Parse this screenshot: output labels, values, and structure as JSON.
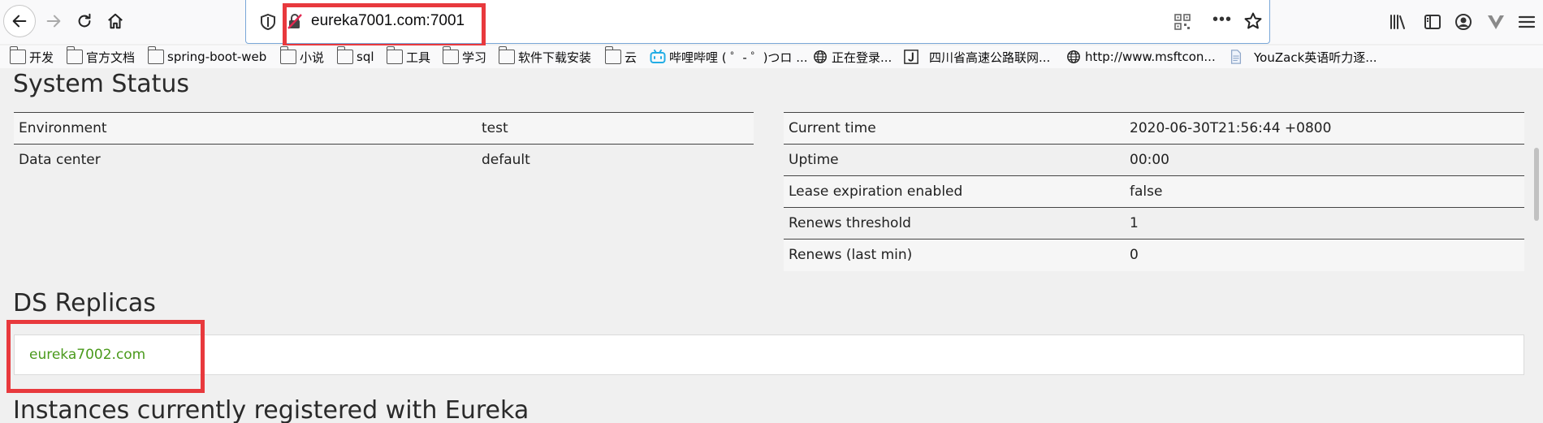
{
  "browser": {
    "url": "eureka7001.com:7001",
    "bookmarks": [
      {
        "label": "开发",
        "icon": "folder-icon"
      },
      {
        "label": "官方文档",
        "icon": "folder-icon"
      },
      {
        "label": "spring-boot-web",
        "icon": "folder-icon"
      },
      {
        "label": "小说",
        "icon": "folder-icon"
      },
      {
        "label": "sql",
        "icon": "folder-icon"
      },
      {
        "label": "工具",
        "icon": "folder-icon"
      },
      {
        "label": "学习",
        "icon": "folder-icon"
      },
      {
        "label": "软件下载安装",
        "icon": "folder-icon"
      },
      {
        "label": "云",
        "icon": "folder-icon"
      },
      {
        "label": "哔哩哔哩 ( ゜- ゜)つロ ...",
        "icon": "bilibili-icon"
      },
      {
        "label": "正在登录...",
        "icon": "globe-icon"
      },
      {
        "label": "四川省高速公路联网...",
        "icon": "j-icon"
      },
      {
        "label": "http://www.msftcon...",
        "icon": "globe-icon"
      },
      {
        "label": "YouZack英语听力逐...",
        "icon": "page-icon"
      }
    ]
  },
  "page": {
    "system_status_title": "System Status",
    "env_rows": [
      {
        "key": "Environment",
        "value": "test"
      },
      {
        "key": "Data center",
        "value": "default"
      }
    ],
    "status_rows": [
      {
        "key": "Current time",
        "value": "2020-06-30T21:56:44 +0800"
      },
      {
        "key": "Uptime",
        "value": "00:00"
      },
      {
        "key": "Lease expiration enabled",
        "value": "false"
      },
      {
        "key": "Renews threshold",
        "value": "1"
      },
      {
        "key": "Renews (last min)",
        "value": "0"
      }
    ],
    "ds_replicas_title": "DS Replicas",
    "replica": "eureka7002.com",
    "instances_title": "Instances currently registered with Eureka"
  },
  "colors": {
    "highlight": "#e8393d",
    "link": "#4a9a1c"
  }
}
